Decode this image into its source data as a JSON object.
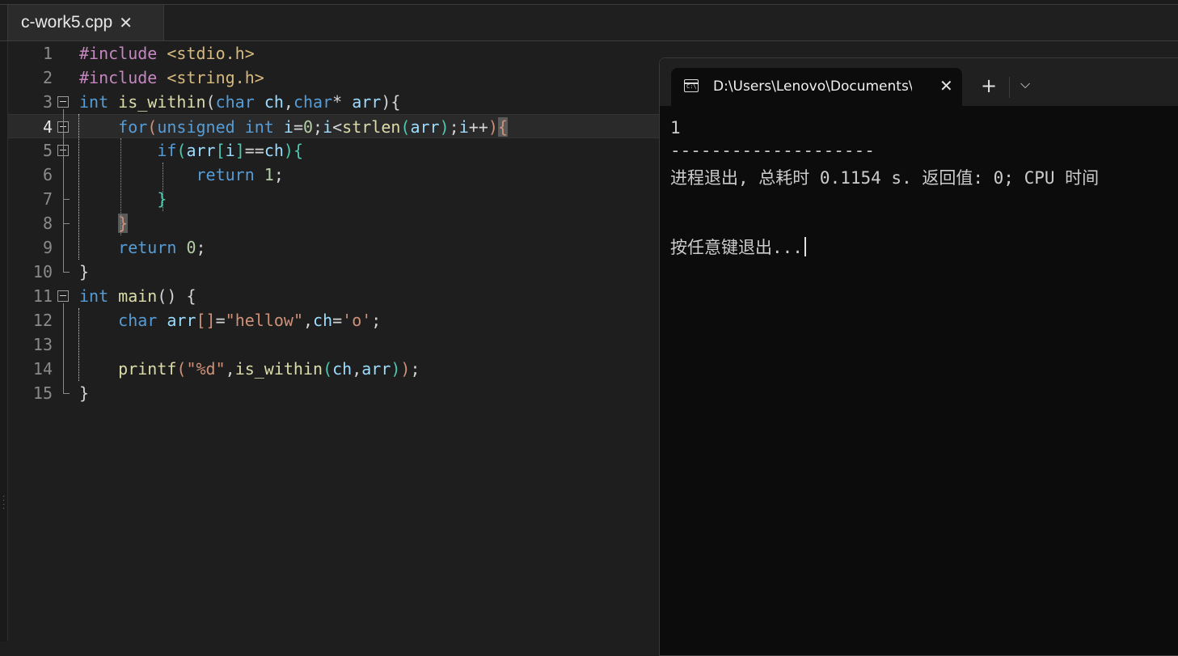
{
  "tab": {
    "title": "c-work5.cpp",
    "close": "✕"
  },
  "editor": {
    "current_line": 4,
    "lines": [
      {
        "num": "1",
        "tokens": [
          [
            "pp",
            "#include"
          ],
          [
            "pun",
            " "
          ],
          [
            "inc",
            "<stdio.h>"
          ]
        ]
      },
      {
        "num": "2",
        "tokens": [
          [
            "pp",
            "#include"
          ],
          [
            "pun",
            " "
          ],
          [
            "inc",
            "<string.h>"
          ]
        ]
      },
      {
        "num": "3",
        "tokens": [
          [
            "kw",
            "int"
          ],
          [
            "pun",
            " "
          ],
          [
            "fn",
            "is_within"
          ],
          [
            "pun",
            "("
          ],
          [
            "kw",
            "char"
          ],
          [
            "pun",
            " "
          ],
          [
            "var",
            "ch"
          ],
          [
            "pun",
            ","
          ],
          [
            "kw",
            "char"
          ],
          [
            "pun",
            "* "
          ],
          [
            "var",
            "arr"
          ],
          [
            "pun",
            "){"
          ]
        ]
      },
      {
        "num": "4",
        "tokens": [
          [
            "pun",
            "    "
          ],
          [
            "kw",
            "for"
          ],
          [
            "str",
            "("
          ],
          [
            "kw",
            "unsigned int"
          ],
          [
            "pun",
            " "
          ],
          [
            "var",
            "i"
          ],
          [
            "pun",
            "="
          ],
          [
            "num",
            "0"
          ],
          [
            "pun",
            ";"
          ],
          [
            "var",
            "i"
          ],
          [
            "pun",
            "<"
          ],
          [
            "fn",
            "strlen"
          ],
          [
            "br2",
            "("
          ],
          [
            "var",
            "arr"
          ],
          [
            "br2",
            ")"
          ],
          [
            "pun",
            ";"
          ],
          [
            "var",
            "i"
          ],
          [
            "pun",
            "++"
          ],
          [
            "str",
            ")"
          ],
          [
            "hl",
            "{"
          ]
        ]
      },
      {
        "num": "5",
        "tokens": [
          [
            "pun",
            "        "
          ],
          [
            "kw",
            "if"
          ],
          [
            "br2",
            "("
          ],
          [
            "var",
            "arr"
          ],
          [
            "br2",
            "["
          ],
          [
            "var",
            "i"
          ],
          [
            "br2",
            "]"
          ],
          [
            "pun",
            "=="
          ],
          [
            "var",
            "ch"
          ],
          [
            "br2",
            "){"
          ]
        ]
      },
      {
        "num": "6",
        "tokens": [
          [
            "pun",
            "            "
          ],
          [
            "kw",
            "return"
          ],
          [
            "pun",
            " "
          ],
          [
            "num",
            "1"
          ],
          [
            "pun",
            ";"
          ]
        ]
      },
      {
        "num": "7",
        "tokens": [
          [
            "pun",
            "        "
          ],
          [
            "br2",
            "}"
          ]
        ]
      },
      {
        "num": "8",
        "tokens": [
          [
            "pun",
            "    "
          ],
          [
            "hl",
            "}"
          ]
        ]
      },
      {
        "num": "9",
        "tokens": [
          [
            "pun",
            "    "
          ],
          [
            "kw",
            "return"
          ],
          [
            "pun",
            " "
          ],
          [
            "num",
            "0"
          ],
          [
            "pun",
            ";"
          ]
        ]
      },
      {
        "num": "10",
        "tokens": [
          [
            "pun",
            "}"
          ]
        ]
      },
      {
        "num": "11",
        "tokens": [
          [
            "kw",
            "int"
          ],
          [
            "pun",
            " "
          ],
          [
            "fn",
            "main"
          ],
          [
            "pun",
            "() {"
          ]
        ]
      },
      {
        "num": "12",
        "tokens": [
          [
            "pun",
            "    "
          ],
          [
            "kw",
            "char"
          ],
          [
            "pun",
            " "
          ],
          [
            "var",
            "arr"
          ],
          [
            "str",
            "[]"
          ],
          [
            "pun",
            "="
          ],
          [
            "str",
            "\"hellow\""
          ],
          [
            "pun",
            ","
          ],
          [
            "var",
            "ch"
          ],
          [
            "pun",
            "="
          ],
          [
            "str",
            "'o'"
          ],
          [
            "pun",
            ";"
          ]
        ]
      },
      {
        "num": "13",
        "tokens": []
      },
      {
        "num": "14",
        "tokens": [
          [
            "pun",
            "    "
          ],
          [
            "fn",
            "printf"
          ],
          [
            "str",
            "("
          ],
          [
            "str",
            "\"%d\""
          ],
          [
            "pun",
            ","
          ],
          [
            "fn",
            "is_within"
          ],
          [
            "br2",
            "("
          ],
          [
            "var",
            "ch"
          ],
          [
            "pun",
            ","
          ],
          [
            "var",
            "arr"
          ],
          [
            "br2",
            ")"
          ],
          [
            "str",
            ")"
          ],
          [
            "pun",
            ";"
          ]
        ]
      },
      {
        "num": "15",
        "tokens": [
          [
            "pun",
            "}"
          ]
        ]
      }
    ]
  },
  "terminal": {
    "tab_title": "D:\\Users\\Lenovo\\Documents\\",
    "close": "✕",
    "new_tab": "+",
    "dropdown": "⌵",
    "output": {
      "line1": "1",
      "separator": "--------------------",
      "exit_info": "进程退出, 总耗时 0.1154 s. 返回值: 0; CPU 时间",
      "prompt": "按任意键退出..."
    }
  }
}
